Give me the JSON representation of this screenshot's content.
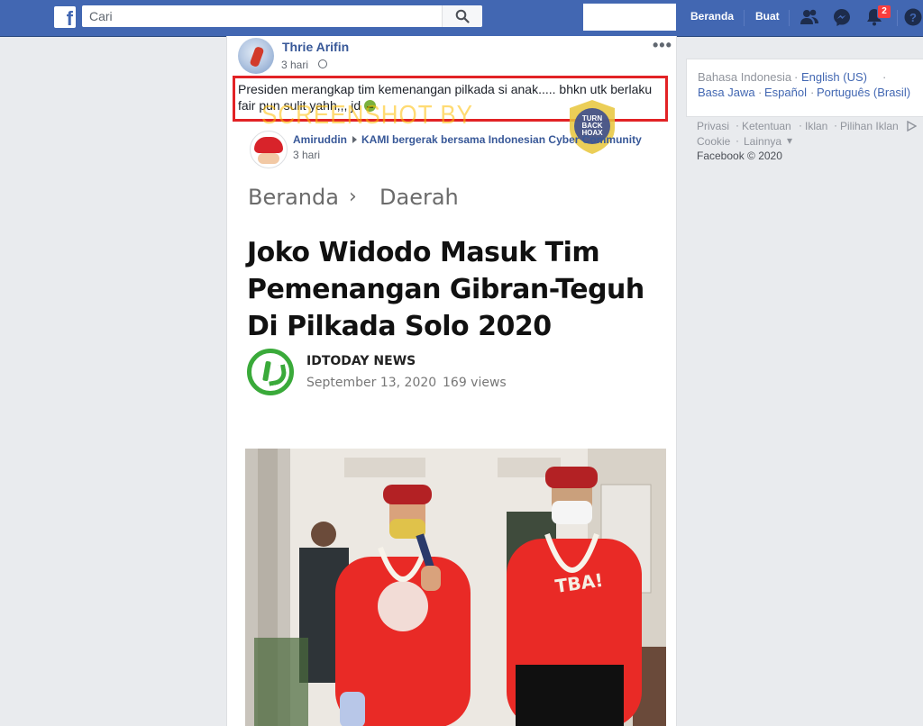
{
  "topbar": {
    "search_placeholder": "Cari",
    "home_label": "Beranda",
    "create_label": "Buat",
    "notifications_count": "2"
  },
  "post": {
    "author": "Thrie Arifin",
    "time": "3 hari",
    "caption": "Presiden merangkap tim kemenangan pilkada si anak..... bhkn utk berlaku fair pun sulit yahh,,, jd",
    "more_label": "•••",
    "watermark": "SCREENSHOT BY",
    "seal_text": "TURN BACK HOAX",
    "shared": {
      "author": "Amiruddin",
      "group": "KAMI bergerak bersama Indonesian Cyber Community",
      "time": "3 hari"
    },
    "article": {
      "breadcrumb_home": "Beranda",
      "breadcrumb_sep": "›",
      "breadcrumb_section": "Daerah",
      "headline": "Joko Widodo Masuk Tim Pemenangan Gibran-Teguh Di Pilkada Solo 2020",
      "source": "IDTODAY NEWS",
      "date": "September 13, 2020",
      "views": "169 views"
    }
  },
  "sidebar": {
    "languages": [
      "Bahasa Indonesia",
      "English (US)",
      "Basa Jawa",
      "Español",
      "Português (Brasil)"
    ],
    "footer_links": [
      "Privasi",
      "Ketentuan",
      "Iklan",
      "Pilihan Iklan",
      "Cookie",
      "Lainnya"
    ],
    "copyright": "Facebook © 2020"
  },
  "colors": {
    "brand": "#4267b2",
    "link": "#385898",
    "highlight_border": "#e22225"
  }
}
